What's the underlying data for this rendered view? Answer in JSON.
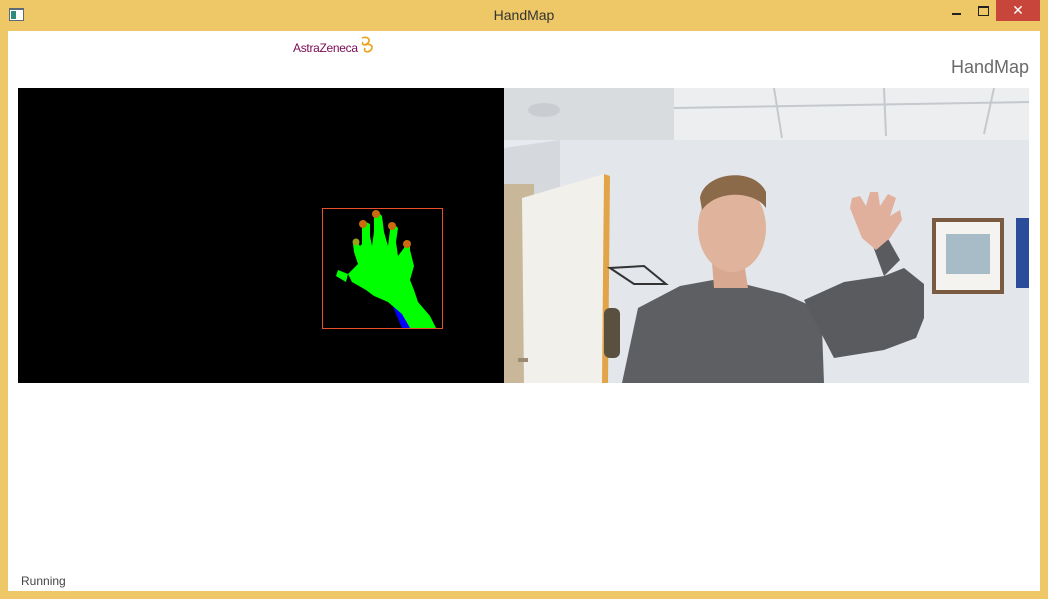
{
  "window": {
    "title": "HandMap",
    "minimize_label": "",
    "maximize_label": "",
    "close_label": "✕"
  },
  "header": {
    "logo_text": "AstraZeneca",
    "title": "HandMap"
  },
  "views": {
    "depth": {
      "icon": "hand-depth-map"
    },
    "camera": {
      "icon": "webcam-feed"
    }
  },
  "status": {
    "text": "Running"
  },
  "colors": {
    "frame": "#eec866",
    "close_button": "#c7453a",
    "logo": "#7b0b54",
    "hand_fill": "#00ff00",
    "hand_edge": "#0000ff",
    "tracking_box": "#e8502a"
  }
}
